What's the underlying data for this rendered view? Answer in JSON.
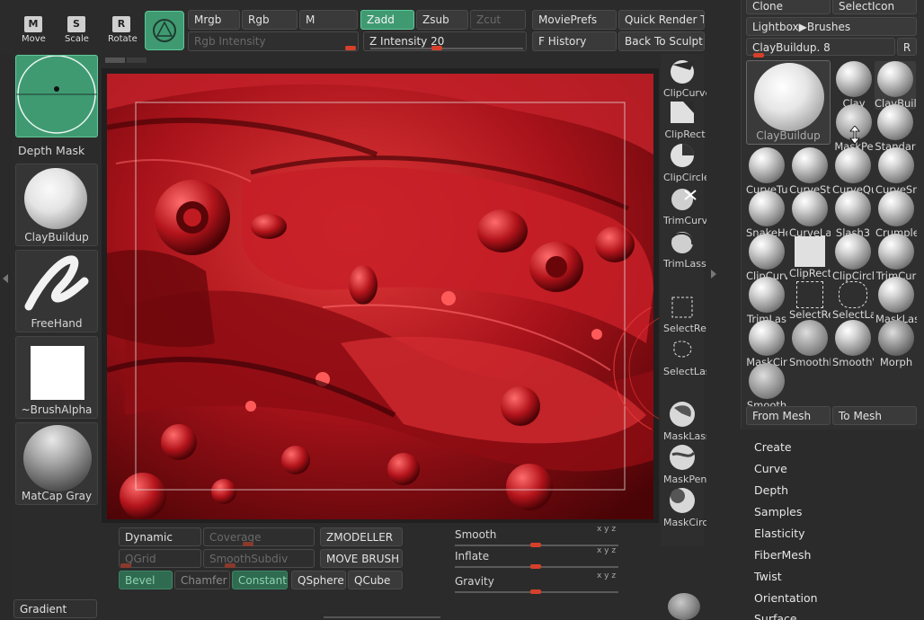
{
  "top_toolbar": {
    "nav_buttons": [
      {
        "icon": "M",
        "label": "Move"
      },
      {
        "icon": "S",
        "label": "Scale"
      },
      {
        "icon": "R",
        "label": "Rotate"
      }
    ],
    "mrgb": "Mrgb",
    "rgb": "Rgb",
    "m": "M",
    "zadd": "Zadd",
    "zsub": "Zsub",
    "zcut": "Zcut",
    "rgb_intensity": "Rgb Intensity",
    "z_intensity_label": "Z Intensity",
    "z_intensity_value": "20",
    "z_intensity_fraction": 0.2,
    "movie_prefs": "MoviePrefs",
    "quick_render": "Quick Render Tes",
    "f_history": "F History",
    "back_to_sculpt": "Back To Sculpt"
  },
  "left_shelf": {
    "depth_mask": "Depth Mask",
    "brush": "ClayBuildup",
    "stroke": "FreeHand",
    "alpha": "~BrushAlpha",
    "material": "MatCap Gray",
    "gradient": "Gradient"
  },
  "right_tools": [
    "ClipCurve",
    "ClipRect",
    "ClipCircle",
    "TrimCurve",
    "TrimLasso",
    "SelectRect",
    "SelectLasso",
    "MaskLasso",
    "MaskPen",
    "MaskCircle"
  ],
  "bottom_bar": {
    "dynamic": "Dynamic",
    "coverage": "Coverage",
    "zmodeller": "ZMODELLER",
    "qgrid": "QGrid",
    "smooth_subdiv": "SmoothSubdiv",
    "move_brush": "MOVE BRUSH",
    "bevel": "Bevel",
    "chamfer": "Chamfer",
    "constant": "Constant",
    "qsphere": "QSphere",
    "qcube": "QCube",
    "smooth": "Smooth",
    "inflate": "Inflate",
    "gravity": "Gravity",
    "xyz": "x y z"
  },
  "brush_palette": {
    "clone": "Clone",
    "select_icon": "SelectIcon",
    "lightbox": "Lightbox▶Brushes",
    "current": "ClayBuildup. 8",
    "r": "R",
    "big_brush": "ClayBuildup",
    "brushes": [
      "Clay",
      "ClayBuil",
      "MaskPe",
      "Standar",
      "CurveTu",
      "CurveSt",
      "CurveQu",
      "CurveSn",
      "SnakeHo",
      "CurveLa",
      "Slash3",
      "Crumple",
      "ClipCurv",
      "ClipRect",
      "ClipCircl",
      "TrimCur",
      "TrimLas",
      "SelectRe",
      "SelectLa",
      "MaskLas",
      "MaskCir",
      "SmoothP",
      "SmoothV",
      "Morph",
      "Smooth"
    ],
    "from_mesh": "From Mesh",
    "to_mesh": "To Mesh"
  },
  "stroke_menu": [
    "Create",
    "Curve",
    "Depth",
    "Samples",
    "Elasticity",
    "FiberMesh",
    "Twist",
    "Orientation",
    "Surface"
  ],
  "colors": {
    "accent_green": "#3f9a72",
    "slider_red": "#d6402a",
    "model_red": "#b5121b"
  }
}
